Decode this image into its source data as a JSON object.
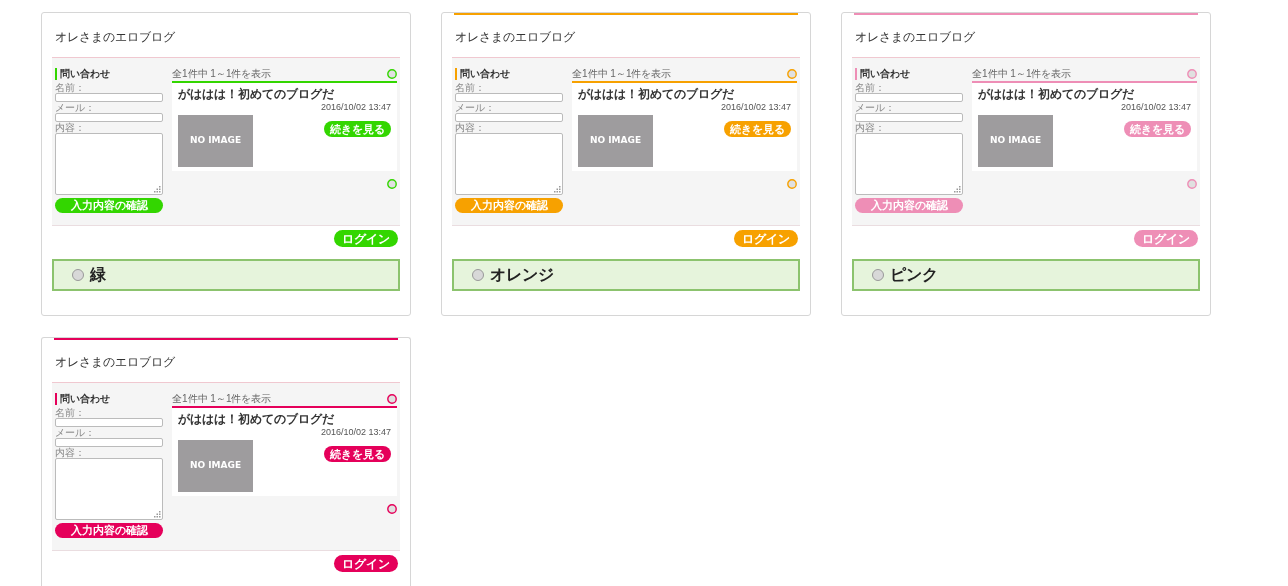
{
  "themes": [
    {
      "label": "緑",
      "color": "#33d600",
      "top_bar": false,
      "selected": false,
      "preview": {
        "blog_title": "オレさまのエロブログ",
        "contact_heading": "問い合わせ",
        "name_label": "名前：",
        "mail_label": "メール：",
        "body_label": "内容：",
        "confirm_button": "入力内容の確認",
        "count": "全1件中 1～1件を表示",
        "post_title": "がははは！初めてのブログだ",
        "post_date": "2016/10/02 13:47",
        "no_image": "NO IMAGE",
        "more_button": "続きを見る",
        "login_button": "ログイン"
      }
    },
    {
      "label": "オレンジ",
      "color": "#f7a100",
      "top_bar": true,
      "selected": false,
      "preview": {
        "blog_title": "オレさまのエロブログ",
        "contact_heading": "問い合わせ",
        "name_label": "名前：",
        "mail_label": "メール：",
        "body_label": "内容：",
        "confirm_button": "入力内容の確認",
        "count": "全1件中 1～1件を表示",
        "post_title": "がははは！初めてのブログだ",
        "post_date": "2016/10/02 13:47",
        "no_image": "NO IMAGE",
        "more_button": "続きを見る",
        "login_button": "ログイン"
      }
    },
    {
      "label": "ピンク",
      "color": "#ee8eb6",
      "top_bar": true,
      "selected": false,
      "preview": {
        "blog_title": "オレさまのエロブログ",
        "contact_heading": "問い合わせ",
        "name_label": "名前：",
        "mail_label": "メール：",
        "body_label": "内容：",
        "confirm_button": "入力内容の確認",
        "count": "全1件中 1～1件を表示",
        "post_title": "がははは！初めてのブログだ",
        "post_date": "2016/10/02 13:47",
        "no_image": "NO IMAGE",
        "more_button": "続きを見る",
        "login_button": "ログイン"
      }
    },
    {
      "color": "#e5005a",
      "top_bar": true,
      "preview": {
        "blog_title": "オレさまのエロブログ",
        "contact_heading": "問い合わせ",
        "name_label": "名前：",
        "mail_label": "メール：",
        "body_label": "内容：",
        "confirm_button": "入力内容の確認",
        "count": "全1件中 1～1件を表示",
        "post_title": "がははは！初めてのブログだ",
        "post_date": "2016/10/02 13:47",
        "no_image": "NO IMAGE",
        "more_button": "続きを見る",
        "login_button": "ログイン"
      }
    }
  ]
}
